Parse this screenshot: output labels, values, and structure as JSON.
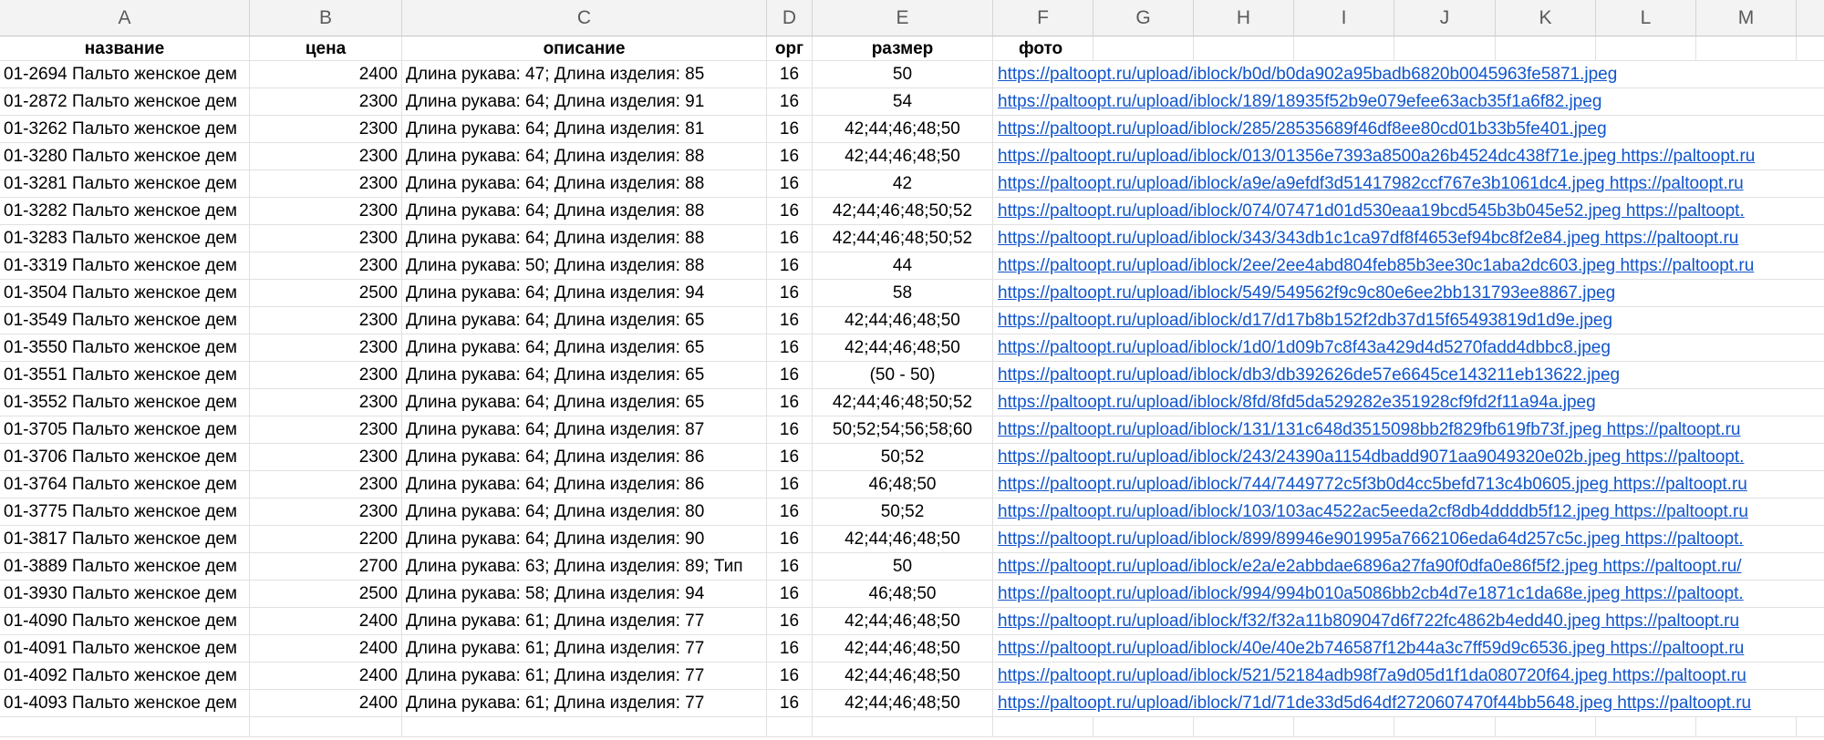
{
  "columns": [
    "A",
    "B",
    "C",
    "D",
    "E",
    "F",
    "G",
    "H",
    "I",
    "J",
    "K",
    "L",
    "M",
    ""
  ],
  "headers": {
    "name": "название",
    "price": "цена",
    "description": "описание",
    "org": "орг",
    "size": "размер",
    "photo": "фото"
  },
  "rows": [
    {
      "name": "01-2694 Пальто женское дем",
      "price": "2400",
      "description": "Длина рукава: 47; Длина изделия: 85",
      "org": "16",
      "size": "50",
      "photo": "https://paltoopt.ru/upload/iblock/b0d/b0da902a95badb6820b0045963fe5871.jpeg"
    },
    {
      "name": "01-2872 Пальто женское дем",
      "price": "2300",
      "description": "Длина рукава: 64; Длина изделия: 91",
      "org": "16",
      "size": "54",
      "photo": "https://paltoopt.ru/upload/iblock/189/18935f52b9e079efee63acb35f1a6f82.jpeg"
    },
    {
      "name": "01-3262 Пальто женское дем",
      "price": "2300",
      "description": "Длина рукава: 64; Длина изделия: 81",
      "org": "16",
      "size": "42;44;46;48;50",
      "photo": "https://paltoopt.ru/upload/iblock/285/28535689f46df8ee80cd01b33b5fe401.jpeg"
    },
    {
      "name": "01-3280 Пальто женское дем",
      "price": "2300",
      "description": "Длина рукава: 64; Длина изделия: 88",
      "org": "16",
      "size": "42;44;46;48;50",
      "photo": "https://paltoopt.ru/upload/iblock/013/01356e7393a8500a26b4524dc438f71e.jpeg https://paltoopt.ru"
    },
    {
      "name": "01-3281 Пальто женское дем",
      "price": "2300",
      "description": "Длина рукава: 64; Длина изделия: 88",
      "org": "16",
      "size": "42",
      "photo": "https://paltoopt.ru/upload/iblock/a9e/a9efdf3d51417982ccf767e3b1061dc4.jpeg https://paltoopt.ru"
    },
    {
      "name": "01-3282 Пальто женское дем",
      "price": "2300",
      "description": "Длина рукава: 64; Длина изделия: 88",
      "org": "16",
      "size": "42;44;46;48;50;52",
      "photo": "https://paltoopt.ru/upload/iblock/074/07471d01d530eaa19bcd545b3b045e52.jpeg https://paltoopt."
    },
    {
      "name": "01-3283 Пальто женское дем",
      "price": "2300",
      "description": "Длина рукава: 64; Длина изделия: 88",
      "org": "16",
      "size": "42;44;46;48;50;52",
      "photo": "https://paltoopt.ru/upload/iblock/343/343db1c1ca97df8f4653ef94bc8f2e84.jpeg https://paltoopt.ru"
    },
    {
      "name": "01-3319 Пальто женское дем",
      "price": "2300",
      "description": "Длина рукава: 50; Длина изделия: 88",
      "org": "16",
      "size": "44",
      "photo": "https://paltoopt.ru/upload/iblock/2ee/2ee4abd804feb85b3ee30c1aba2dc603.jpeg https://paltoopt.ru"
    },
    {
      "name": "01-3504 Пальто женское дем",
      "price": "2500",
      "description": "Длина рукава: 64; Длина изделия: 94",
      "org": "16",
      "size": "58",
      "photo": "https://paltoopt.ru/upload/iblock/549/549562f9c9c80e6ee2bb131793ee8867.jpeg"
    },
    {
      "name": "01-3549 Пальто женское дем",
      "price": "2300",
      "description": "Длина рукава: 64; Длина изделия: 65",
      "org": "16",
      "size": "42;44;46;48;50",
      "photo": "https://paltoopt.ru/upload/iblock/d17/d17b8b152f2db37d15f65493819d1d9e.jpeg"
    },
    {
      "name": "01-3550 Пальто женское дем",
      "price": "2300",
      "description": "Длина рукава: 64; Длина изделия: 65",
      "org": "16",
      "size": "42;44;46;48;50",
      "photo": "https://paltoopt.ru/upload/iblock/1d0/1d09b7c8f43a429d4d5270fadd4dbbc8.jpeg"
    },
    {
      "name": "01-3551 Пальто женское дем",
      "price": "2300",
      "description": "Длина рукава: 64; Длина изделия: 65",
      "org": "16",
      "size": "(50 - 50)",
      "photo": "https://paltoopt.ru/upload/iblock/db3/db392626de57e6645ce143211eb13622.jpeg"
    },
    {
      "name": "01-3552 Пальто женское дем",
      "price": "2300",
      "description": "Длина рукава: 64; Длина изделия: 65",
      "org": "16",
      "size": "42;44;46;48;50;52",
      "photo": "https://paltoopt.ru/upload/iblock/8fd/8fd5da529282e351928cf9fd2f11a94a.jpeg"
    },
    {
      "name": "01-3705 Пальто женское дем",
      "price": "2300",
      "description": "Длина рукава: 64; Длина изделия: 87",
      "org": "16",
      "size": "50;52;54;56;58;60",
      "photo": "https://paltoopt.ru/upload/iblock/131/131c648d3515098bb2f829fb619fb73f.jpeg https://paltoopt.ru"
    },
    {
      "name": "01-3706 Пальто женское дем",
      "price": "2300",
      "description": "Длина рукава: 64; Длина изделия: 86",
      "org": "16",
      "size": "50;52",
      "photo": "https://paltoopt.ru/upload/iblock/243/24390a1154dbadd9071aa9049320e02b.jpeg https://paltoopt."
    },
    {
      "name": "01-3764 Пальто женское дем",
      "price": "2300",
      "description": "Длина рукава: 64; Длина изделия: 86",
      "org": "16",
      "size": "46;48;50",
      "photo": "https://paltoopt.ru/upload/iblock/744/7449772c5f3b0d4cc5befd713c4b0605.jpeg https://paltoopt.ru"
    },
    {
      "name": "01-3775 Пальто женское дем",
      "price": "2300",
      "description": "Длина рукава: 64; Длина изделия: 80",
      "org": "16",
      "size": "50;52",
      "photo": "https://paltoopt.ru/upload/iblock/103/103ac4522ac5eeda2cf8db4ddddb5f12.jpeg https://paltoopt.ru"
    },
    {
      "name": "01-3817 Пальто женское дем",
      "price": "2200",
      "description": "Длина рукава: 64; Длина изделия: 90",
      "org": "16",
      "size": "42;44;46;48;50",
      "photo": "https://paltoopt.ru/upload/iblock/899/89946e901995a7662106eda64d257c5c.jpeg https://paltoopt."
    },
    {
      "name": "01-3889 Пальто женское дем",
      "price": "2700",
      "description": "Длина рукава: 63; Длина изделия: 89; Тип",
      "org": "16",
      "size": "50",
      "photo": "https://paltoopt.ru/upload/iblock/e2a/e2abbdae6896a27fa90f0dfa0e86f5f2.jpeg https://paltoopt.ru/"
    },
    {
      "name": "01-3930 Пальто женское дем",
      "price": "2500",
      "description": "Длина рукава: 58; Длина изделия: 94",
      "org": "16",
      "size": "46;48;50",
      "photo": "https://paltoopt.ru/upload/iblock/994/994b010a5086bb2cb4d7e1871c1da68e.jpeg https://paltoopt."
    },
    {
      "name": "01-4090 Пальто женское дем",
      "price": "2400",
      "description": "Длина рукава: 61; Длина изделия: 77",
      "org": "16",
      "size": "42;44;46;48;50",
      "photo": "https://paltoopt.ru/upload/iblock/f32/f32a11b809047d6f722fc4862b4edd40.jpeg https://paltoopt.ru"
    },
    {
      "name": "01-4091 Пальто женское дем",
      "price": "2400",
      "description": "Длина рукава: 61; Длина изделия: 77",
      "org": "16",
      "size": "42;44;46;48;50",
      "photo": "https://paltoopt.ru/upload/iblock/40e/40e2b746587f12b44a3c7ff59d9c6536.jpeg https://paltoopt.ru"
    },
    {
      "name": "01-4092 Пальто женское дем",
      "price": "2400",
      "description": "Длина рукава: 61; Длина изделия: 77",
      "org": "16",
      "size": "42;44;46;48;50",
      "photo": "https://paltoopt.ru/upload/iblock/521/52184adb98f7a9d05d1f1da080720f64.jpeg https://paltoopt.ru"
    },
    {
      "name": "01-4093 Пальто женское дем",
      "price": "2400",
      "description": "Длина рукава: 61; Длина изделия: 77",
      "org": "16",
      "size": "42;44;46;48;50",
      "photo": "https://paltoopt.ru/upload/iblock/71d/71de33d5d64df2720607470f44bb5648.jpeg https://paltoopt.ru"
    }
  ],
  "colors": {
    "link": "#1155cc",
    "header_bg": "#f3f3f3",
    "grid": "#e1e1e1"
  }
}
